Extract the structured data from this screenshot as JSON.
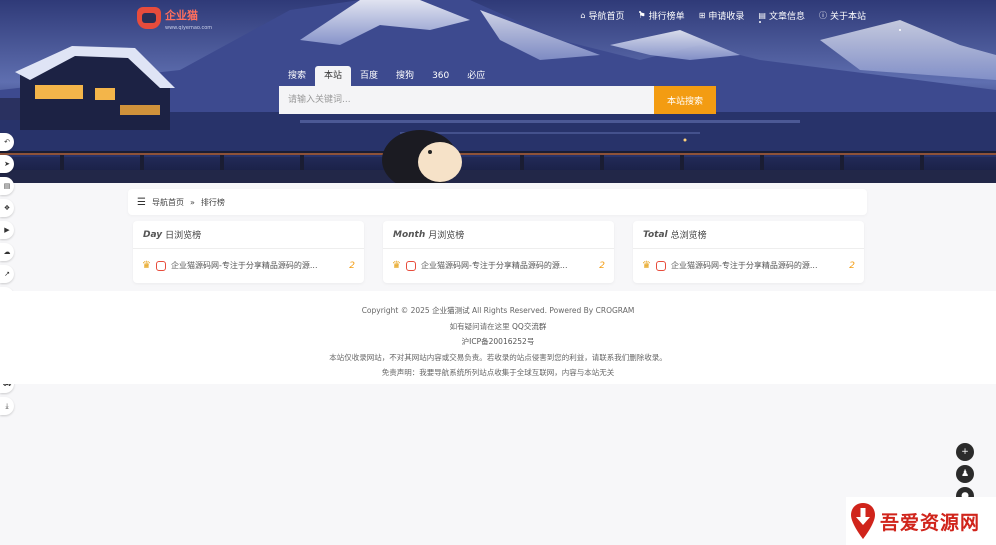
{
  "logo": {
    "name": "企业猫",
    "subtitle": "www.qiyemao.com"
  },
  "nav": [
    {
      "icon": "home-icon",
      "glyph": "⌂",
      "label": "导航首页"
    },
    {
      "icon": "flag-icon",
      "glyph": "⚑",
      "label": "排行榜单"
    },
    {
      "icon": "plus-square-icon",
      "glyph": "⊞",
      "label": "申请收录"
    },
    {
      "icon": "book-icon",
      "glyph": "▤",
      "label": "文章信息"
    },
    {
      "icon": "info-icon",
      "glyph": "ⓘ",
      "label": "关于本站"
    }
  ],
  "search": {
    "tabs": [
      "搜索",
      "本站",
      "百度",
      "搜狗",
      "360",
      "必应"
    ],
    "active_tab": "本站",
    "placeholder": "请输入关键词...",
    "button": "本站搜索"
  },
  "sidebar": [
    {
      "icon": "undo-icon",
      "glyph": "↶"
    },
    {
      "icon": "send-icon",
      "glyph": "➤"
    },
    {
      "icon": "document-icon",
      "glyph": "▤"
    },
    {
      "icon": "cubes-icon",
      "glyph": "❖"
    },
    {
      "icon": "video-icon",
      "glyph": "▶"
    },
    {
      "icon": "cloud-icon",
      "glyph": "☁"
    },
    {
      "icon": "chart-line-icon",
      "glyph": "↗"
    },
    {
      "icon": "graduation-cap-icon",
      "glyph": "▲"
    },
    {
      "icon": "yen-icon",
      "glyph": "¥"
    },
    {
      "icon": "wrench-icon",
      "glyph": "⚒"
    },
    {
      "icon": "keyboard-icon",
      "glyph": "⌨"
    },
    {
      "icon": "cart-icon",
      "glyph": "⛟"
    },
    {
      "icon": "download-icon",
      "glyph": "⤓"
    }
  ],
  "breadcrumb": {
    "home": "导航首页",
    "sep": "»",
    "current": "排行榜"
  },
  "cards": [
    {
      "en": "Day",
      "cn": "日浏览榜",
      "item": "企业猫源码网-专注于分享精品源码的源...",
      "count": "2"
    },
    {
      "en": "Month",
      "cn": "月浏览榜",
      "item": "企业猫源码网-专注于分享精品源码的源...",
      "count": "2"
    },
    {
      "en": "Total",
      "cn": "总浏览榜",
      "item": "企业猫源码网-专注于分享精品源码的源...",
      "count": "2"
    }
  ],
  "footer": {
    "copyright_pre": "Copyright © 2025",
    "site": "企业猫测试",
    "copyright_post": "All Rights Reserved. Powered By CROGRAM",
    "contact_pre": "如有疑问请在这里",
    "contact_link": "QQ交流群",
    "icp": "沪ICP备20016252号",
    "notice": "本站仅收录网站，不对其网站内容或交易负责。若收录的站点侵害到您的利益，请联系我们删除收录。",
    "disclaimer": "免责声明：我要导航系统所列站点收集于全球互联网，内容与本站无关"
  },
  "right_buttons": [
    {
      "icon": "plus-icon",
      "glyph": "+"
    },
    {
      "icon": "qq-icon",
      "glyph": "♟"
    },
    {
      "icon": "wechat-icon",
      "glyph": "●"
    }
  ],
  "watermark": {
    "text": "吾爱资源网"
  },
  "colors": {
    "accent": "#f39c12",
    "brand_red": "#e74c3c",
    "crown": "#e6a117"
  }
}
